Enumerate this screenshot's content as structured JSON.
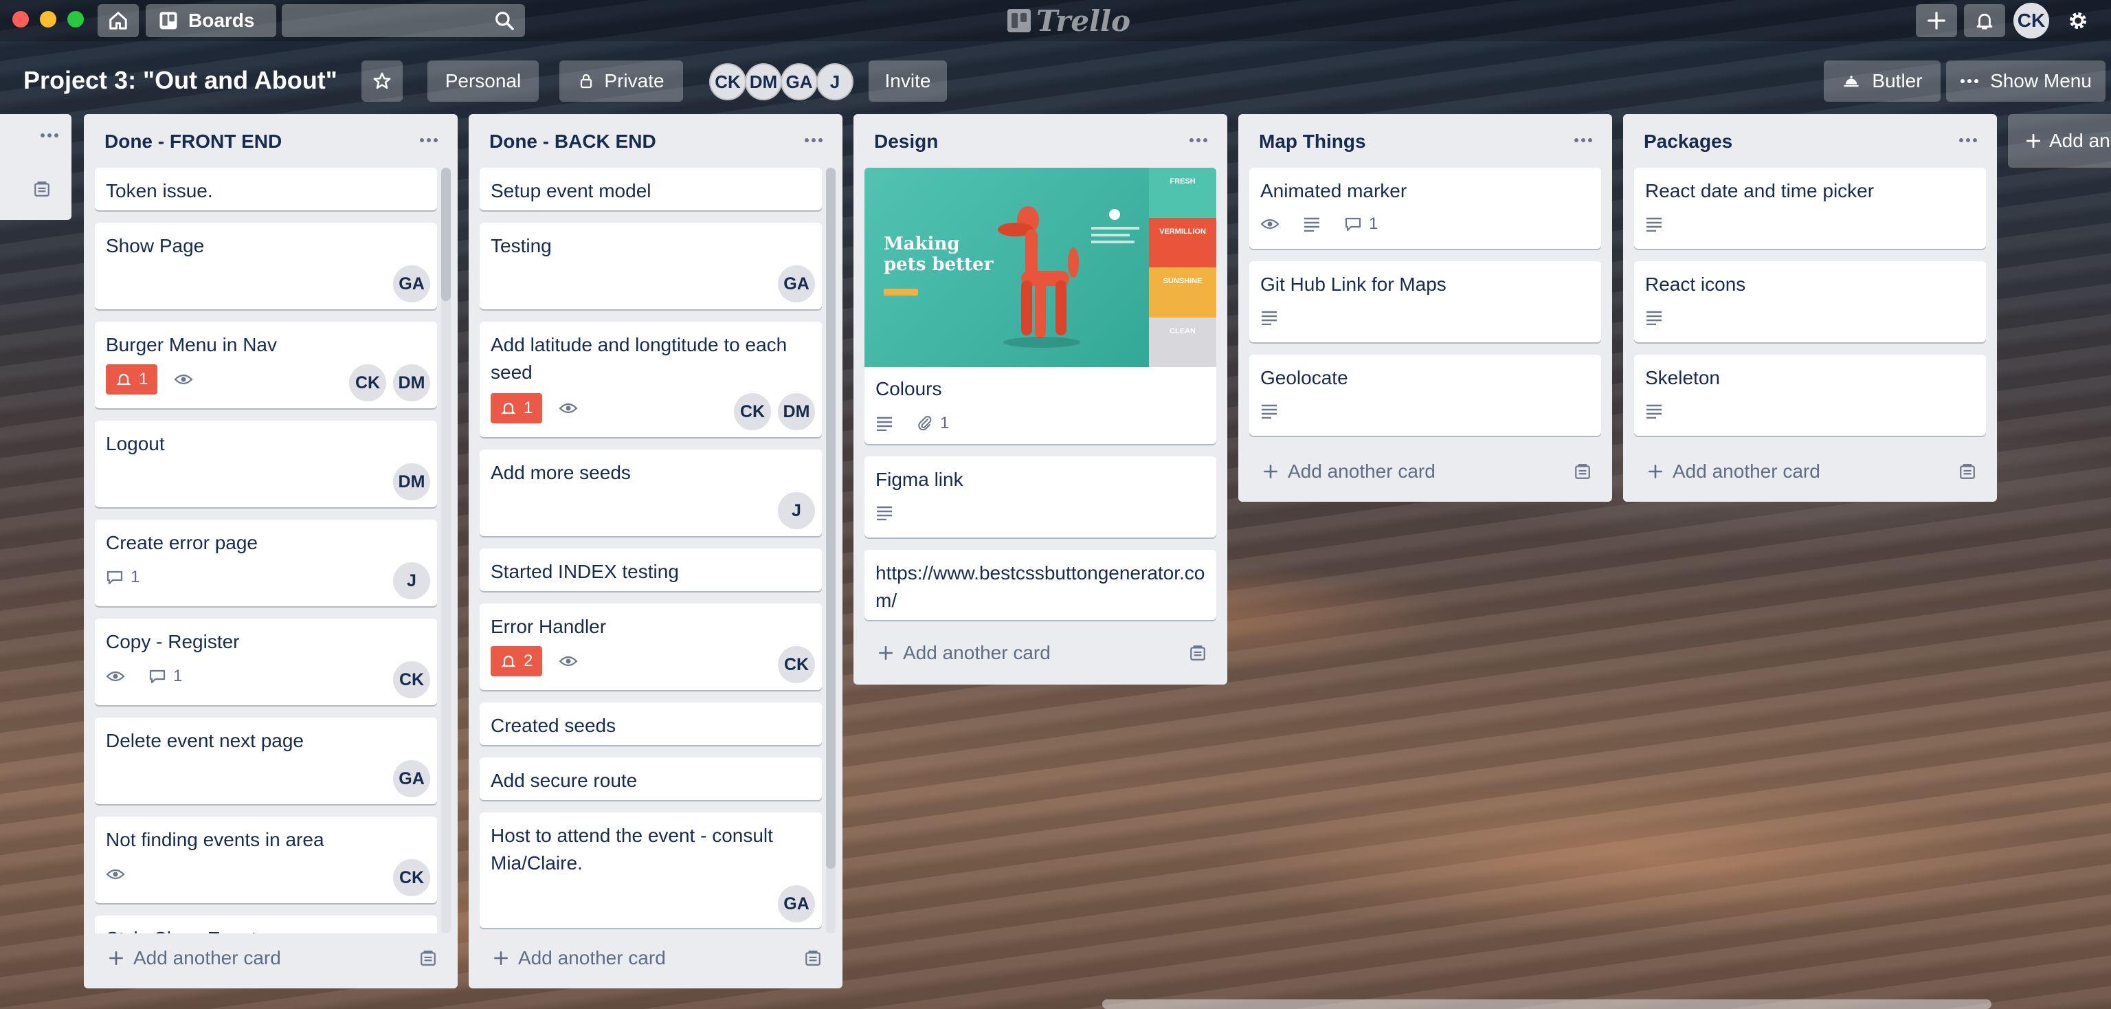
{
  "app": {
    "logo_text": "Trello"
  },
  "topbar": {
    "boards_label": "Boards",
    "search_placeholder": "",
    "user_initials": "CK"
  },
  "board": {
    "title": "Project 3: \"Out and About\"",
    "personal_label": "Personal",
    "private_label": "Private",
    "members": [
      "CK",
      "DM",
      "GA",
      "J"
    ],
    "invite_label": "Invite",
    "butler_label": "Butler",
    "show_menu_label": "Show Menu"
  },
  "lists": {
    "collapsed": {
      "title": ""
    },
    "front": {
      "title": "Done - FRONT END",
      "cards": [
        {
          "title": "Token issue."
        },
        {
          "title": "Show Page",
          "members": [
            "GA"
          ]
        },
        {
          "title": "Burger Menu in Nav",
          "due": "1",
          "members": [
            "CK",
            "DM"
          ]
        },
        {
          "title": "Logout",
          "members": [
            "DM"
          ]
        },
        {
          "title": "Create error page",
          "comments": "1",
          "members": [
            "J"
          ]
        },
        {
          "title": "Copy - Register",
          "comments": "1",
          "members": [
            "CK"
          ]
        },
        {
          "title": "Delete event next page",
          "members": [
            "GA"
          ]
        },
        {
          "title": "Not finding events in area",
          "members": [
            "CK"
          ]
        },
        {
          "title": "Style Show Event page"
        }
      ],
      "add_card_label": "Add another card"
    },
    "back": {
      "title": "Done - BACK END",
      "cards": [
        {
          "title": "Setup event model"
        },
        {
          "title": "Testing",
          "members": [
            "GA"
          ]
        },
        {
          "title": "Add latitude and longtitude to each seed",
          "due": "1",
          "members": [
            "CK",
            "DM"
          ]
        },
        {
          "title": "Add more seeds",
          "members": [
            "J"
          ]
        },
        {
          "title": "Started INDEX testing"
        },
        {
          "title": "Error Handler",
          "due": "2",
          "members": [
            "CK"
          ]
        },
        {
          "title": "Created seeds"
        },
        {
          "title": "Add secure route"
        },
        {
          "title": "Host to attend the event - consult Mia/Claire.",
          "members": [
            "GA"
          ]
        }
      ],
      "add_card_label": "Add another card"
    },
    "design": {
      "title": "Design",
      "cover": {
        "headline_1": "Making",
        "headline_2": "pets better",
        "swatches": [
          {
            "label": "FRESH",
            "color": "#4fc3ae"
          },
          {
            "label": "VERMILLION",
            "color": "#e8553a"
          },
          {
            "label": "SUNSHINE",
            "color": "#f2b240"
          },
          {
            "label": "CLEAN",
            "color": "#d8d8dc"
          }
        ]
      },
      "cards": [
        {
          "title": "Colours",
          "attachments": "1"
        },
        {
          "title": "Figma link"
        },
        {
          "title": "https://www.bestcssbuttongenerator.com/"
        }
      ],
      "add_card_label": "Add another card"
    },
    "map": {
      "title": "Map Things",
      "cards": [
        {
          "title": "Animated marker",
          "comments": "1"
        },
        {
          "title": "Git Hub Link for Maps"
        },
        {
          "title": "Geolocate"
        }
      ],
      "add_card_label": "Add another card"
    },
    "packages": {
      "title": "Packages",
      "cards": [
        {
          "title": "React date and time picker"
        },
        {
          "title": "React icons"
        },
        {
          "title": "Skeleton"
        }
      ],
      "add_card_label": "Add another card"
    },
    "add_list_label": "Add another list"
  },
  "colors": {
    "due_badge": "#eb5a46",
    "list_bg": "#ebecf0",
    "design_teal": "#3db6a4"
  }
}
